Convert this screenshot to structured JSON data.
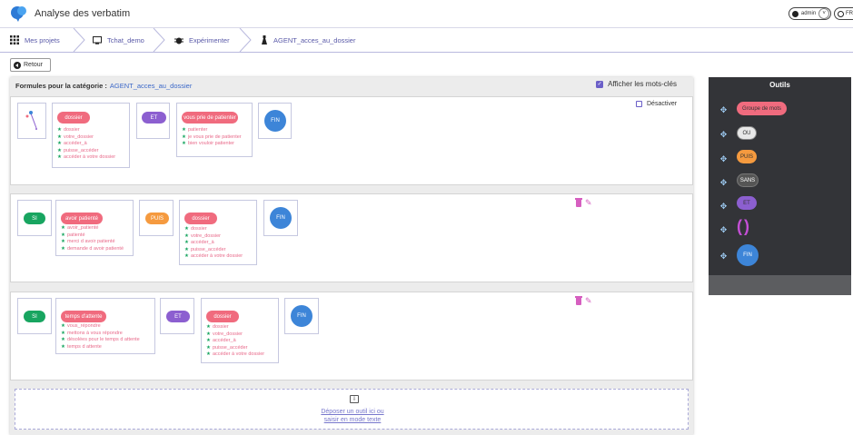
{
  "app": {
    "title": "Analyse des verbatim"
  },
  "user": {
    "name": "admin",
    "lang": "FR"
  },
  "breadcrumb": [
    {
      "label": "Mes projets",
      "icon": "grid-icon"
    },
    {
      "label": "Tchat_demo",
      "icon": "monitor-icon"
    },
    {
      "label": "Expérimenter",
      "icon": "bug-icon"
    },
    {
      "label": "AGENT_acces_au_dossier",
      "icon": "flask-icon"
    }
  ],
  "retour_label": "Retour",
  "panel": {
    "heading": "Formules pour la catégorie :",
    "category": "AGENT_acces_au_dossier",
    "show_keywords_label": "Afficher les mots-clés",
    "show_keywords": true
  },
  "rules": [
    {
      "desactiver_label": "Désactiver",
      "groups": [
        {
          "label": "dossier",
          "keywords": [
            "dossier",
            "votre_dossier",
            "accéder_à",
            "puisse_accéder",
            "accéder à votre dossier"
          ]
        },
        {
          "op": "ET"
        },
        {
          "label": "vous prie de patienter",
          "keywords": [
            "patienter",
            "je vous prie de patienter",
            "bien vouloir patienter"
          ]
        },
        {
          "op": "FIN"
        }
      ]
    },
    {
      "groups": [
        {
          "op": "SI"
        },
        {
          "label": "avoir patienté",
          "keywords": [
            "avoir_patienté",
            "patienté",
            "merci d avoir patienté",
            "demande d avoir patienté"
          ]
        },
        {
          "op": "PUIS"
        },
        {
          "label": "dossier",
          "keywords": [
            "dossier",
            "votre_dossier",
            "accéder_à",
            "puisse_accéder",
            "accéder à votre dossier"
          ]
        },
        {
          "op": "FIN"
        }
      ]
    },
    {
      "groups": [
        {
          "op": "SI"
        },
        {
          "label": "temps d'attente",
          "keywords": [
            "vous_répondre",
            "mettons à vous répondre",
            "désolées pour le temps d attente",
            "temps d attente"
          ]
        },
        {
          "op": "ET"
        },
        {
          "label": "dossier",
          "keywords": [
            "dossier",
            "votre_dossier",
            "accéder_à",
            "puisse_accéder",
            "accéder à votre dossier"
          ]
        },
        {
          "op": "FIN"
        }
      ]
    }
  ],
  "drop": {
    "line1": "Déposer un outil ici ou",
    "line2": "saisir en mode texte"
  },
  "tools": {
    "title": "Outils",
    "items": [
      {
        "label": "Groupe de mots",
        "color": "#f06b7e"
      },
      {
        "label": "OU",
        "color": "#e8e8e8"
      },
      {
        "label": "PUIS",
        "color": "#f59a3f"
      },
      {
        "label": "SANS",
        "color": "#555555"
      },
      {
        "label": "ET",
        "color": "#8c5fd0"
      },
      {
        "label": "()",
        "color": "#c44fd6"
      },
      {
        "label": "FIN",
        "color": "#3d85d8"
      }
    ]
  }
}
